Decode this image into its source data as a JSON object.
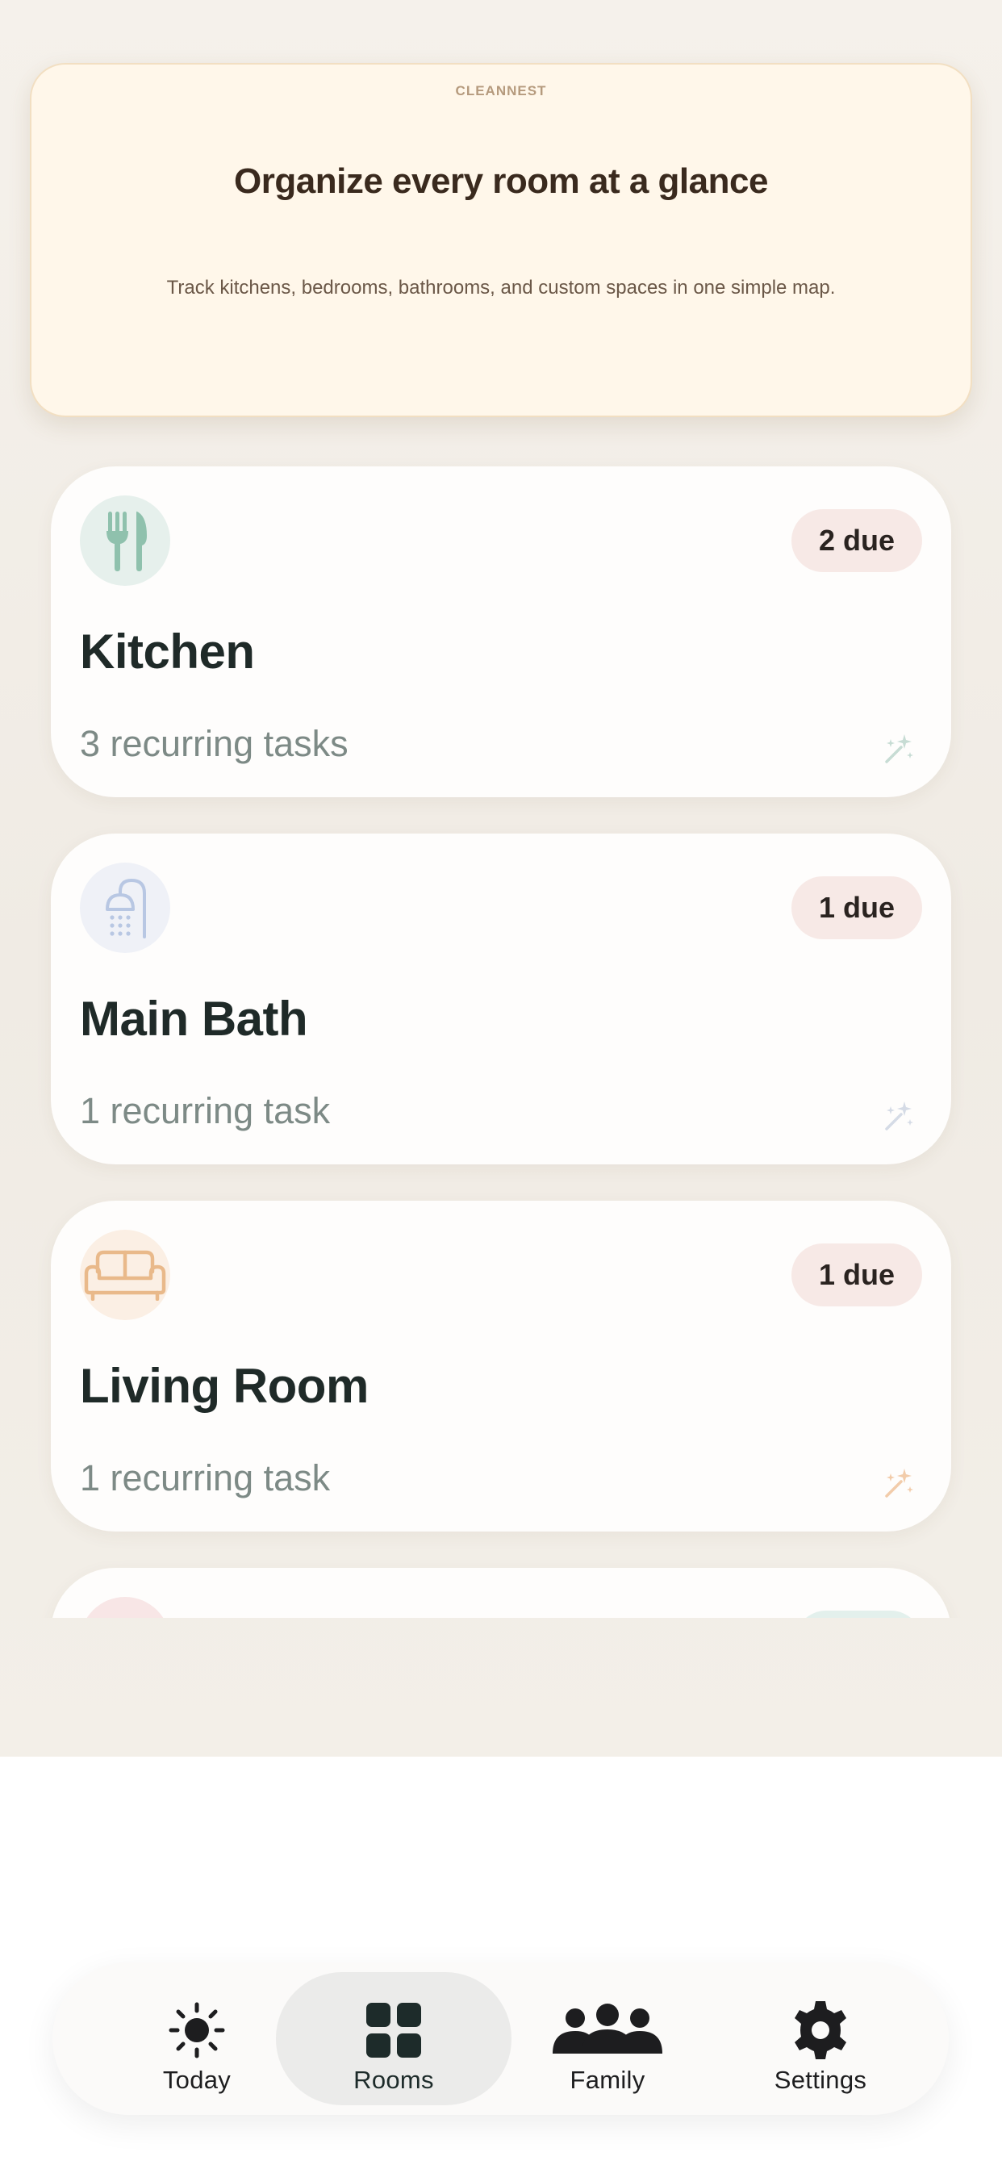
{
  "hero": {
    "eyebrow": "CLEANNEST",
    "title": "Organize every room at a glance",
    "subtitle": "Track kitchens, bedrooms, bathrooms, and custom spaces in one simple map."
  },
  "rooms": [
    {
      "name": "Kitchen",
      "tasks": "3 recurring tasks",
      "due": "2 due",
      "icon": "fork-knife-icon",
      "icon_color": "#8fc1ad",
      "icon_bg": "#e6f0ec"
    },
    {
      "name": "Main Bath",
      "tasks": "1 recurring task",
      "due": "1 due",
      "icon": "shower-icon",
      "icon_color": "#b8c7e3",
      "icon_bg": "#eff1f7"
    },
    {
      "name": "Living Room",
      "tasks": "1 recurring task",
      "due": "1 due",
      "icon": "sofa-icon",
      "icon_color": "#e9b98a",
      "icon_bg": "#fbefe4"
    }
  ],
  "partial_card": {
    "icon_bg": "#f8e6e6",
    "badge_bg": "#e3f0ec"
  },
  "tabs": [
    {
      "label": "Today",
      "icon": "sun-icon",
      "active": false
    },
    {
      "label": "Rooms",
      "icon": "grid-icon",
      "active": true
    },
    {
      "label": "Family",
      "icon": "people-icon",
      "active": false
    },
    {
      "label": "Settings",
      "icon": "gear-icon",
      "active": false
    }
  ],
  "colors": {
    "background": "#f3efe8",
    "hero_bg": "#fff7ea",
    "due_badge_bg": "#f7e9e6",
    "text_dark": "#1f2a28",
    "text_muted": "#7d8a86"
  }
}
